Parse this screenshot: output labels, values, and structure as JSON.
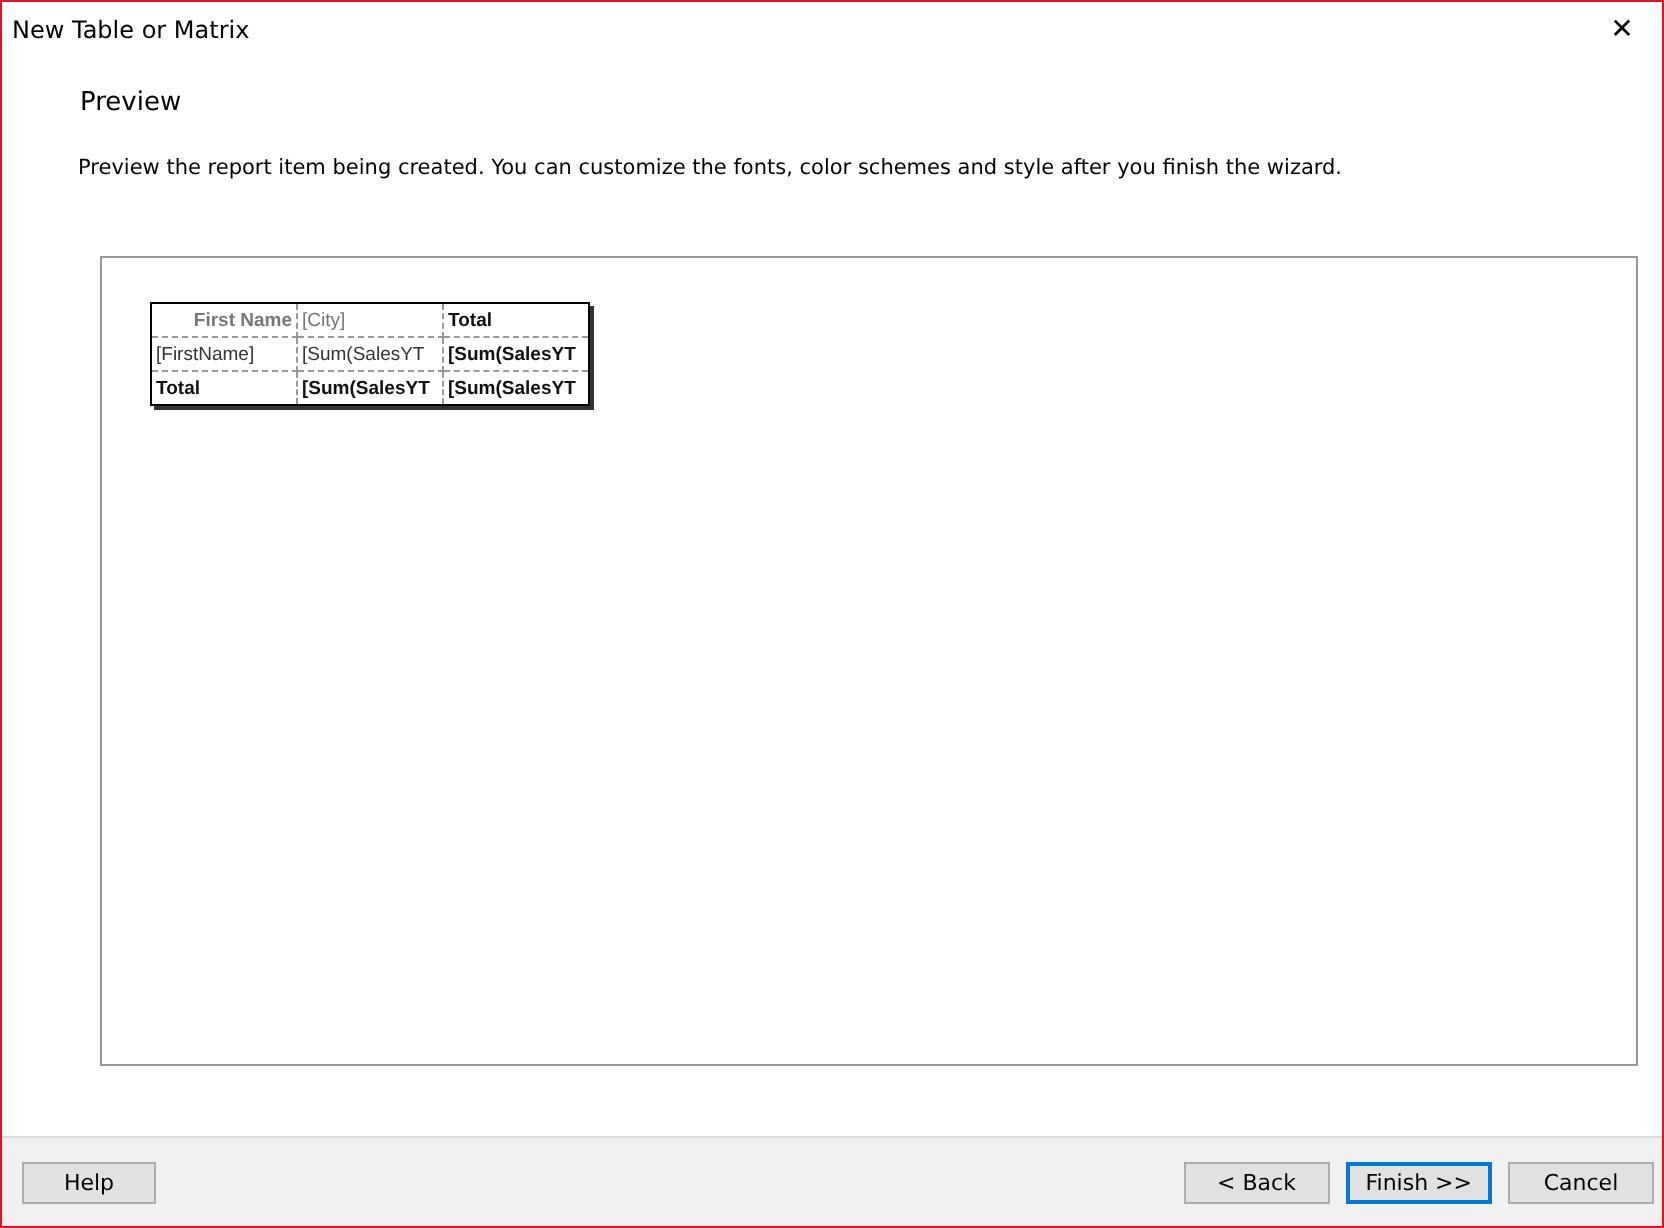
{
  "window": {
    "title": "New Table or Matrix",
    "close": "✕"
  },
  "heading": "Preview",
  "description": "Preview the report item being created. You can customize the fonts, color schemes and style after you finish the wizard.",
  "preview_table": {
    "rows": [
      [
        {
          "text": "First Name",
          "kind": "caption"
        },
        {
          "text": "[City]",
          "kind": "group"
        },
        {
          "text": "Total",
          "kind": "total"
        }
      ],
      [
        {
          "text": "[FirstName]",
          "kind": "field"
        },
        {
          "text": "[Sum(SalesYT",
          "kind": "field"
        },
        {
          "text": "[Sum(SalesYT",
          "kind": "total"
        }
      ],
      [
        {
          "text": "Total",
          "kind": "total"
        },
        {
          "text": "[Sum(SalesYT",
          "kind": "total"
        },
        {
          "text": "[Sum(SalesYT",
          "kind": "total"
        }
      ]
    ]
  },
  "buttons_left": [
    {
      "label": "Help",
      "default": false
    }
  ],
  "buttons_right": [
    {
      "label": "< Back",
      "default": false
    },
    {
      "label": "Finish >>",
      "default": true
    },
    {
      "label": "Cancel",
      "default": false
    }
  ]
}
